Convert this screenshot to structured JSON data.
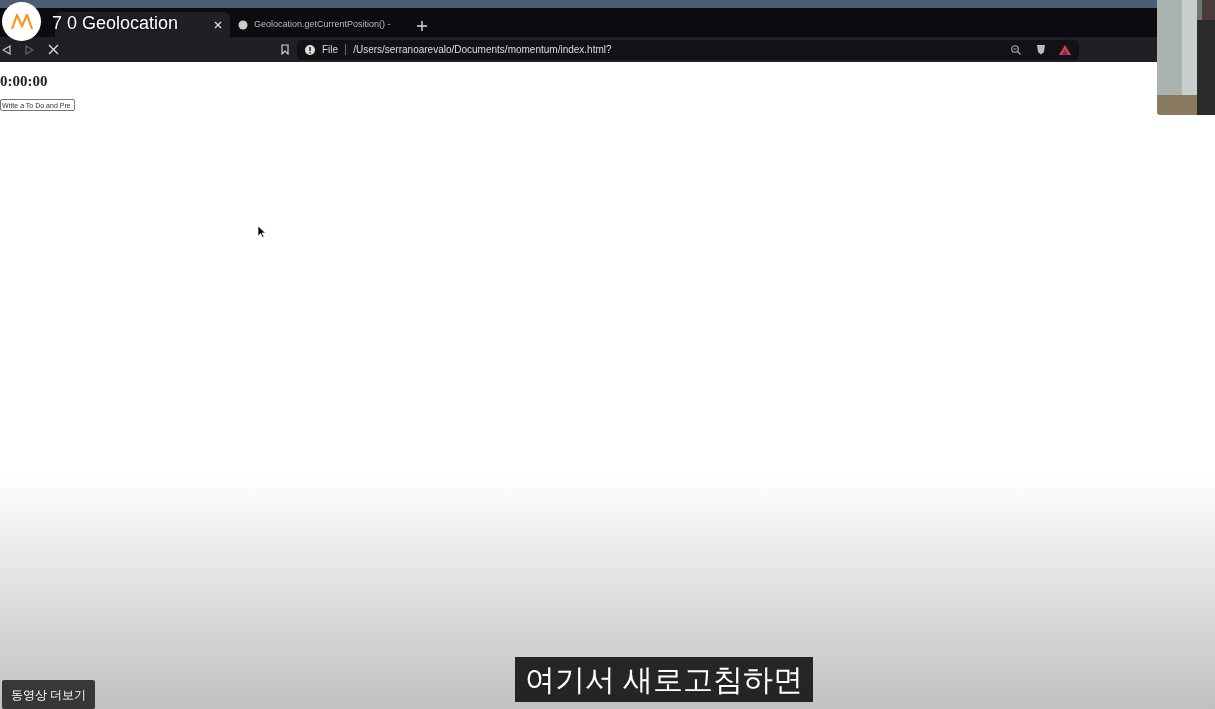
{
  "video_title": "7 0 Geolocation",
  "browser": {
    "tabs": [
      {
        "selected": true
      },
      {
        "title": "Geolocation.getCurrentPosition() -",
        "selected": false
      }
    ],
    "address": {
      "scheme": "File",
      "url": "/Users/serranoarevalo/Documents/momentum/index.html?"
    }
  },
  "page": {
    "clock": "0:00:00",
    "todo_input": {
      "placeholder": "Write a To Do and Pre"
    }
  },
  "subtitle": "여기서 새로고침하면",
  "more_videos_button": "동영상 더보기"
}
